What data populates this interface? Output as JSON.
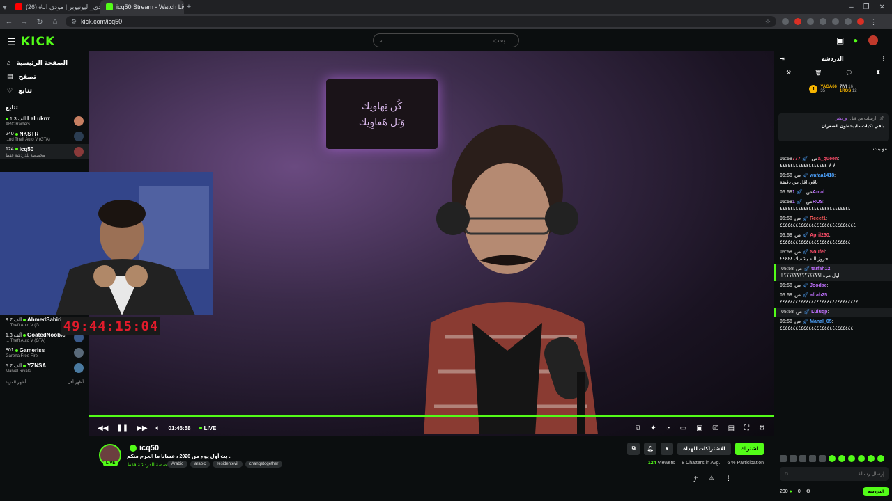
{
  "browser": {
    "tabs": [
      {
        "label": "(26) #تحدي_اليوتيوبر | مودي الـ...",
        "active": false,
        "color": "#ff0000"
      },
      {
        "label": "icq50 Stream - Watch Live ...",
        "active": true,
        "color": "#53fc18"
      }
    ],
    "new_tab": "+",
    "url": "kick.com/icq50"
  },
  "header": {
    "logo": "KICK",
    "search_placeholder": "بحث"
  },
  "sidebar": {
    "nav": [
      {
        "label": "الصفحة الرئيسية",
        "icon": "home-icon"
      },
      {
        "label": "تصفح",
        "icon": "browse-icon"
      },
      {
        "label": "تتابع",
        "icon": "heart-icon"
      }
    ],
    "following_title": "تتابع",
    "channels_top": [
      {
        "name": "LaLukrrr",
        "game": "ARC Raiders",
        "viewers": "1.3 ألف"
      },
      {
        "name": "NKSTR",
        "game": "...nd Theft Auto V (GTA)",
        "viewers": "240"
      },
      {
        "name": "icq50",
        "game": "مخصصة للدردشة فقط",
        "viewers": "124"
      }
    ],
    "channels_bottom": [
      {
        "name": "AhmedSabiri",
        "game": "... Theft Auto V (G",
        "viewers": "9.7 ألف"
      },
      {
        "name": "GoatedNoobie",
        "game": "... Theft Auto V (GTA)",
        "viewers": "1.3 ألف"
      },
      {
        "name": "Gameriss",
        "game": "Garena Free Fire",
        "viewers": "801"
      },
      {
        "name": "YZNSA",
        "game": "Marvel Rivals",
        "viewers": "5.7 ألف"
      }
    ],
    "show_more": "أظهر المزيد",
    "show_less": "أظهر أقل"
  },
  "overlay": {
    "countdown": "49:44:15:04"
  },
  "player": {
    "sign_line1": "كُن تِهاويك",
    "sign_line2": "وَنَل هَفاوِيك",
    "time": "01:46:58",
    "live_label": "LIVE"
  },
  "stream": {
    "channel": "icq50",
    "live_badge": "LIVE",
    "title": "بث أول يوم من 2026 ، عسانا ما الحرم منكم ..",
    "category": "مخصصة للدردشة فقط",
    "tags": [
      "Arabic",
      "arabic",
      "residentevil",
      "changetogether"
    ],
    "subscribe_label": "اشتراك",
    "gift_label": "الاشتراكات للهداة",
    "viewers": "124",
    "viewers_label": "Viewers",
    "chatters": "8",
    "chatters_label": "Chatters in Avg.",
    "participation": "6",
    "participation_label": "% Participation"
  },
  "chat": {
    "title": "الدردشة",
    "leaders": [
      {
        "rank": "1",
        "name": "YAGA66",
        "count": "35"
      },
      {
        "name": "7IVI",
        "count": "16"
      },
      {
        "name": "1ROS",
        "count": "12"
      }
    ],
    "pinned_user": "و_بشر",
    "pinned_meta": "أرسلت من قبل",
    "pinned_text": "باقي تكيات مابيحطون الضعران",
    "pre_line": "مو بنت",
    "messages": [
      {
        "time": "05:58",
        "user": "777a_queen",
        "color": "#ff4d6a",
        "text": "لا لا ٤٤٤٤٤٤٤٤٤٤٤٤٤٤٤٤٤٤"
      },
      {
        "time": "05:58",
        "user": "wafaa1418",
        "color": "#4da3ff",
        "text": "باقي اقل من دقيقة"
      },
      {
        "time": "05:58",
        "user": "1Amal",
        "color": "#c070ff",
        "text": ""
      },
      {
        "time": "05:58",
        "user": "1ROS",
        "color": "#c070ff",
        "text": "٤٤٤٤٤٤٤٤٤٤٤٤٤٤٤٤٤٤٤٤٤٤٤٤٤٤٤"
      },
      {
        "time": "05:58",
        "user": "Reeef1",
        "color": "#ff5a5a",
        "text": "٤٤٤٤٤٤٤٤٤٤٤٤٤٤٤٤٤٤٤٤٤٤٤٤٤٤٤٤٤"
      },
      {
        "time": "05:58",
        "user": "April230",
        "color": "#ff4d6a",
        "text": "٤٤٤٤٤٤٤٤٤٤٤٤٤٤٤٤٤٤٤٤٤٤٤٤٤٤٤"
      },
      {
        "time": "05:58",
        "user": "Noufei",
        "color": "#ff4d6a",
        "text": "حزوز الله يشفيك ٤٤٤٤٤"
      },
      {
        "time": "05:58",
        "user": "tarfah12",
        "color": "#c070ff",
        "text": "اول مره !؟؟؟؟؟؟؟؟؟؟؟؟؟؟ !"
      },
      {
        "time": "05:58",
        "user": "Joodae",
        "color": "#c070ff",
        "text": ""
      },
      {
        "time": "05:58",
        "user": "afrah25",
        "color": "#c070ff",
        "text": "٤٤٤٤٤٤٤٤٤٤٤٤٤٤٤٤٤٤٤٤٤٤٤٤٤٤٤٤٤٤"
      },
      {
        "time": "05:58",
        "user": "Luluqp",
        "color": "#c070ff",
        "text": ""
      },
      {
        "time": "05:58",
        "user": "Manal_05",
        "color": "#4da3ff",
        "text": "٤٤٤٤٤٤٤٤٤٤٤٤٤٤٤٤٤٤٤٤٤٤٤٤٤٤٤٤"
      }
    ],
    "time_prefix": "ص",
    "input_placeholder": "إرسال رسالة",
    "points": "200",
    "count": "0",
    "send_label": "الدردشة"
  }
}
